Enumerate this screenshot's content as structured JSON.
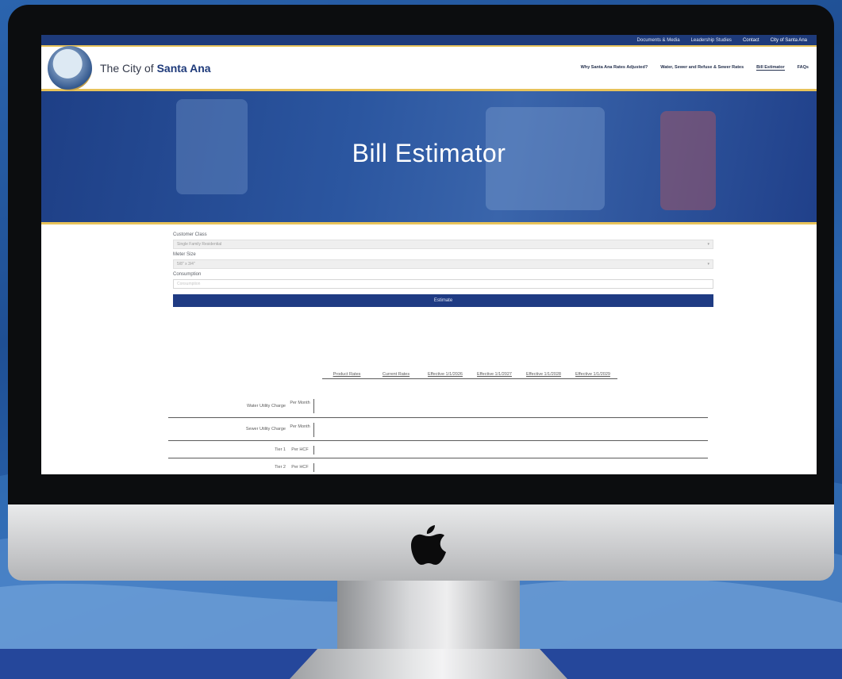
{
  "colors": {
    "background": "#2b64ae",
    "bottom_band": "#25479b",
    "site_navy": "#1e3a7a",
    "accent_gold": "#e8c35a",
    "estimate_button": "#1f3b83"
  },
  "topbar": {
    "links": [
      "Documents & Media",
      "Leadership Studies",
      "Contact",
      "City of Santa Ana"
    ]
  },
  "header": {
    "title_prefix": "The City of ",
    "title_bold": "Santa Ana",
    "nav": [
      "Why Santa Ana Rates Adjusted?",
      "Water, Sewer and Refuse & Sewer Rates",
      "Bill Estimator",
      "FAQs"
    ]
  },
  "hero": {
    "title": "Bill Estimator"
  },
  "form": {
    "customer_class_label": "Customer Class",
    "customer_class_value": "Single Family Residential",
    "meter_size_label": "Meter Size",
    "meter_size_value": "5/8\" x 3/4\"",
    "consumption_label": "Consumption",
    "consumption_placeholder": "Consumption",
    "estimate_button": "Estimate"
  },
  "table": {
    "columns": [
      "Product Rates",
      "Current Rates",
      "Effective 1/1/2026",
      "Effective 1/1/2027",
      "Effective 1/1/2028",
      "Effective 1/1/2029"
    ],
    "rows": [
      {
        "name": "Water Utility Charge",
        "unit": "Per Month"
      },
      {
        "name": "Sewer Utility Charge",
        "unit": "Per Month"
      },
      {
        "name": "Tier 1",
        "unit": "Per HCF"
      },
      {
        "name": "Tier 2",
        "unit": "Per HCF"
      }
    ]
  },
  "icons": {
    "logo": "city-seal-icon",
    "apple": "apple-logo-icon",
    "dropdown": "chevron-down-icon"
  }
}
